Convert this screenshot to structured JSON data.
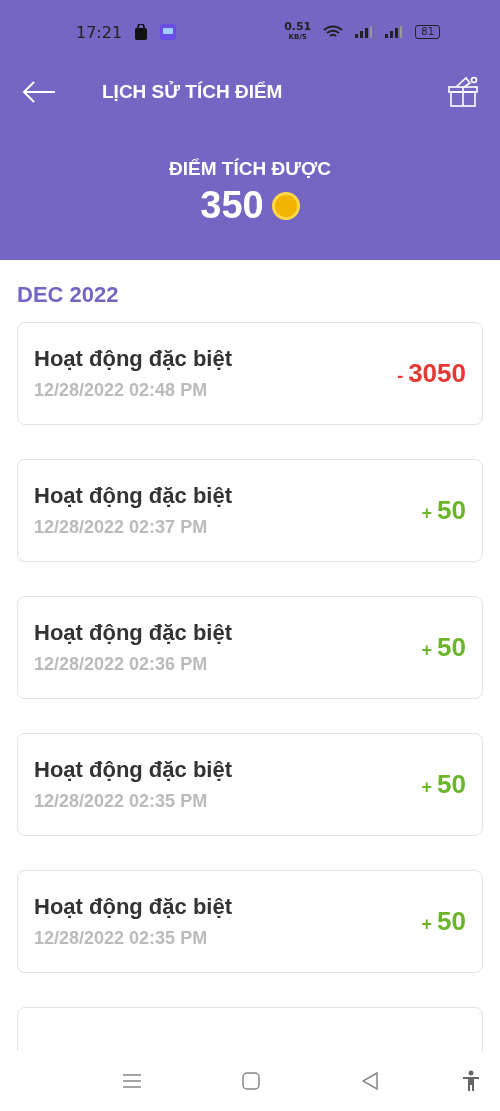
{
  "status_bar": {
    "time": "17:21",
    "speed": "0.51",
    "speed_unit": "KB/S",
    "battery": "81"
  },
  "header": {
    "title": "LỊCH SỬ TÍCH ĐIỂM",
    "points_label": "ĐIỂM TÍCH ĐƯỢC",
    "points": "350"
  },
  "section": "DEC 2022",
  "transactions": [
    {
      "title": "Hoạt động đặc biệt",
      "date": "12/28/2022 02:48 PM",
      "kind": "debit",
      "sign": "-",
      "amount": "3050"
    },
    {
      "title": "Hoạt động đặc biệt",
      "date": "12/28/2022 02:37 PM",
      "kind": "credit",
      "sign": "+",
      "amount": "50"
    },
    {
      "title": "Hoạt động đặc biệt",
      "date": "12/28/2022 02:36 PM",
      "kind": "credit",
      "sign": "+",
      "amount": "50"
    },
    {
      "title": "Hoạt động đặc biệt",
      "date": "12/28/2022 02:35 PM",
      "kind": "credit",
      "sign": "+",
      "amount": "50"
    },
    {
      "title": "Hoạt động đặc biệt",
      "date": "12/28/2022 02:35 PM",
      "kind": "credit",
      "sign": "+",
      "amount": "50"
    }
  ]
}
